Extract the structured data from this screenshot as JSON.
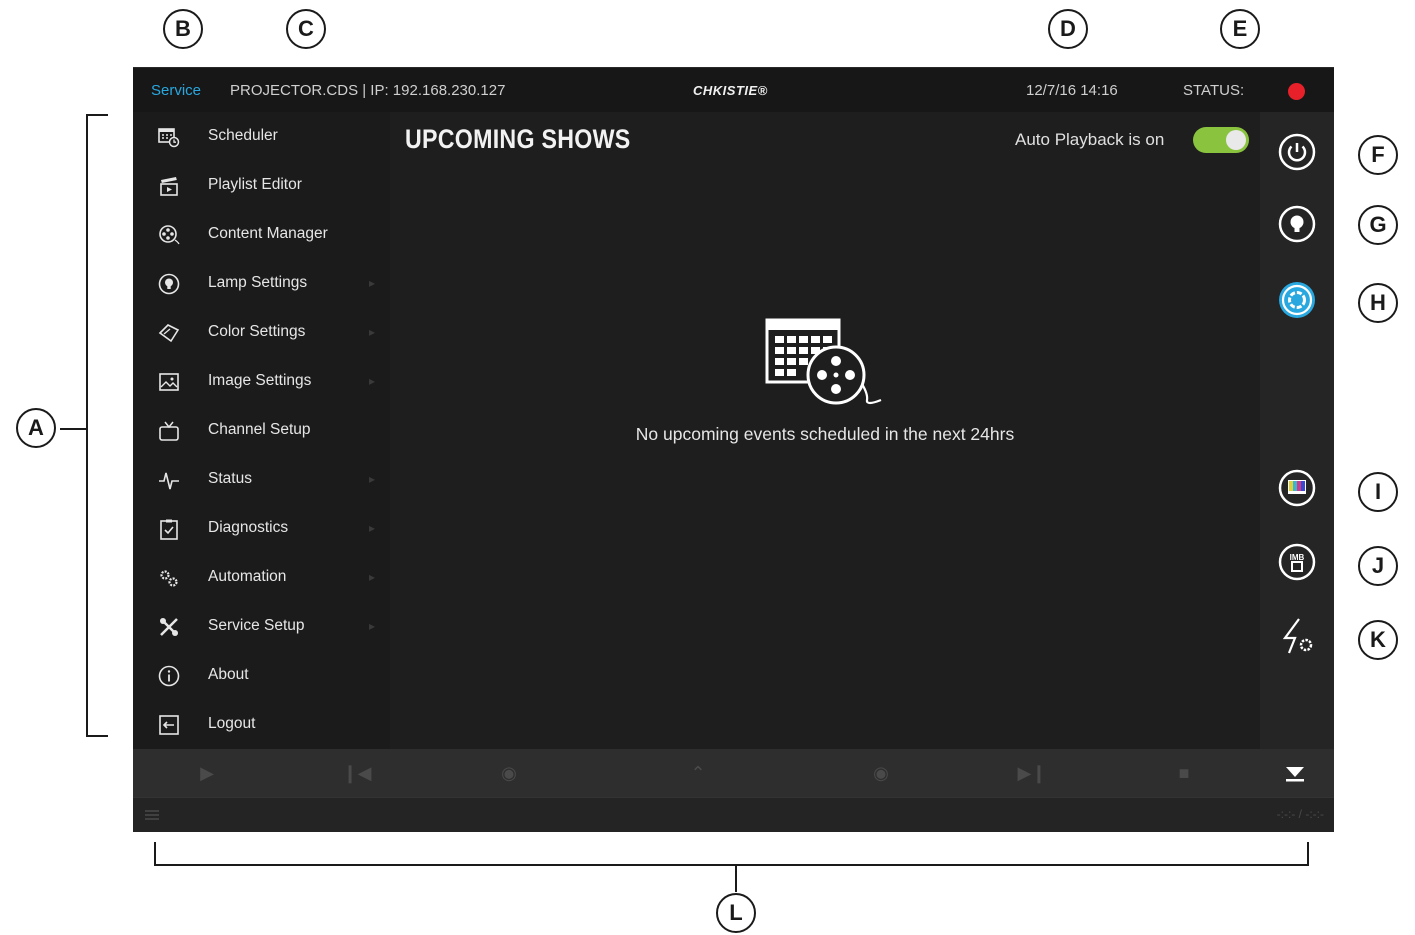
{
  "callouts": {
    "a": "A",
    "b": "B",
    "c": "C",
    "d": "D",
    "e": "E",
    "f": "F",
    "g": "G",
    "h": "H",
    "i": "I",
    "j": "J",
    "k": "K",
    "l": "L"
  },
  "topbar": {
    "mode": "Service",
    "host": "PROJECTOR.CDS | IP: 192.168.230.127",
    "logo": "CHKISTIE®",
    "datetime": "12/7/16  14:16",
    "status_label": "STATUS:",
    "status_color": "#e8202a",
    "mode_color": "#29a8e0"
  },
  "sidebar": {
    "items": [
      {
        "label": "Scheduler",
        "icon": "calendar-clock-icon"
      },
      {
        "label": "Playlist Editor",
        "icon": "clapperboard-icon"
      },
      {
        "label": "Content Manager",
        "icon": "film-reel-icon"
      },
      {
        "label": "Lamp Settings",
        "icon": "lightbulb-icon"
      },
      {
        "label": "Color Settings",
        "icon": "color-eraser-icon"
      },
      {
        "label": "Image Settings",
        "icon": "image-icon"
      },
      {
        "label": "Channel Setup",
        "icon": "tv-icon"
      },
      {
        "label": "Status",
        "icon": "heartbeat-icon"
      },
      {
        "label": "Diagnostics",
        "icon": "clipboard-check-icon"
      },
      {
        "label": "Automation",
        "icon": "gears-icon"
      },
      {
        "label": "Service Setup",
        "icon": "tools-icon"
      },
      {
        "label": "About",
        "icon": "info-icon"
      },
      {
        "label": "Logout",
        "icon": "logout-icon"
      }
    ]
  },
  "main": {
    "title": "UPCOMING SHOWS",
    "auto_playback_label": "Auto Playback is on",
    "auto_playback_on": true,
    "toggle_color": "#8ac43f",
    "empty_message": "No upcoming events scheduled in the next 24hrs"
  },
  "rightbar": {
    "buttons": [
      "power-icon",
      "lamp-icon",
      "douser-icon",
      "test-pattern-icon",
      "imb-icon",
      "power-settings-icon"
    ],
    "active_color": "#29a8e0"
  },
  "transport": {
    "buttons": [
      "play-icon",
      "skip-back-icon",
      "rewind-icon",
      "eject-icon",
      "forward-icon",
      "skip-forward-icon",
      "stop-icon"
    ]
  },
  "statusbar": {
    "time": "-:-:- / -:-:-"
  }
}
